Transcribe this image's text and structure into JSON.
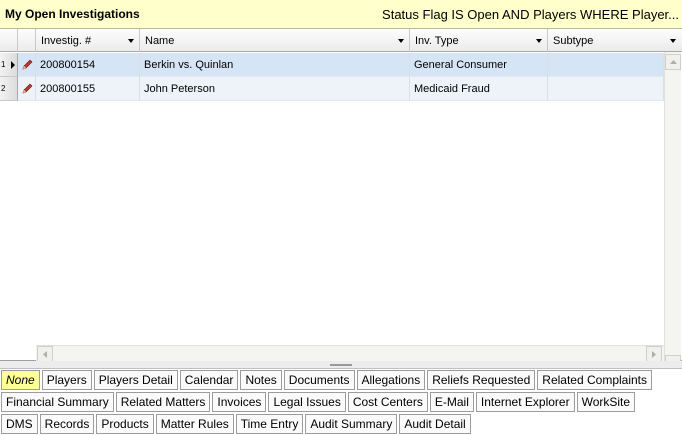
{
  "header": {
    "title": "My Open Investigations",
    "filter": "Status Flag IS Open AND Players WHERE Player..."
  },
  "grid": {
    "columns": [
      {
        "label": "Investig. #"
      },
      {
        "label": "Name"
      },
      {
        "label": "Inv. Type"
      },
      {
        "label": "Subtype"
      }
    ],
    "rows": [
      {
        "num": "1",
        "inv": "200800154",
        "name": "Berkin vs. Quinlan",
        "type": "General Consumer",
        "subtype": ""
      },
      {
        "num": "2",
        "inv": "200800155",
        "name": "John Peterson",
        "type": "Medicaid Fraud",
        "subtype": ""
      }
    ]
  },
  "tabs": {
    "row1": [
      "None",
      "Players",
      "Players Detail",
      "Calendar",
      "Notes",
      "Documents",
      "Allegations",
      "Reliefs Requested",
      "Related Complaints"
    ],
    "row2": [
      "Financial Summary",
      "Related Matters",
      "Invoices",
      "Legal Issues",
      "Cost Centers",
      "E-Mail",
      "Internet Explorer",
      "WorkSite"
    ],
    "row3": [
      "DMS",
      "Records",
      "Products",
      "Matter Rules",
      "Time Entry",
      "Audit Summary",
      "Audit Detail"
    ],
    "active": "None"
  },
  "icons": {
    "row_edit": "pencil-icon",
    "row_pointer": "row-pointer-icon",
    "column_dropdown": "chevron-down-icon"
  }
}
